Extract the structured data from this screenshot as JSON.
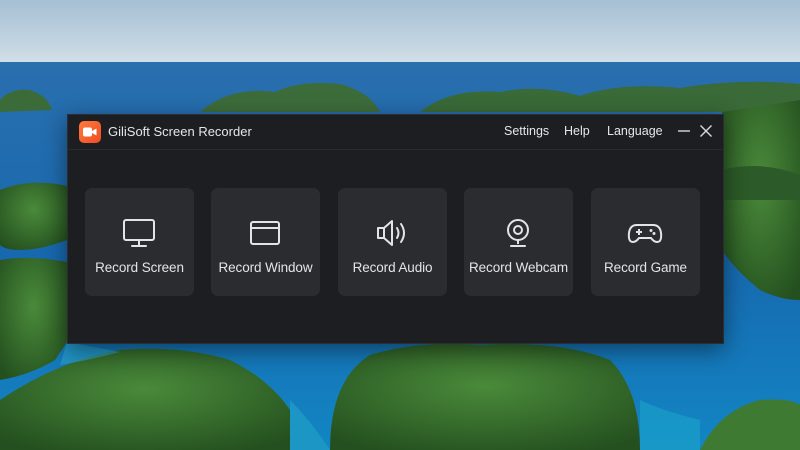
{
  "window": {
    "title": "GiliSoft Screen Recorder",
    "logo_icon": "video-camera-icon",
    "logo_color": "#f25a2a"
  },
  "menu": {
    "settings": "Settings",
    "help": "Help",
    "language": "Language"
  },
  "window_controls": {
    "minimize_icon": "minimize-icon",
    "close_icon": "close-icon"
  },
  "actions": [
    {
      "label": "Record Screen",
      "icon": "monitor-icon"
    },
    {
      "label": "Record Window",
      "icon": "window-icon"
    },
    {
      "label": "Record Audio",
      "icon": "speaker-icon"
    },
    {
      "label": "Record Webcam",
      "icon": "webcam-icon"
    },
    {
      "label": "Record Game",
      "icon": "gamepad-icon"
    }
  ],
  "colors": {
    "window_bg": "#1d1e22",
    "card_bg": "#2b2c30",
    "text": "#e4e4e6",
    "accent": "#f25a2a"
  }
}
